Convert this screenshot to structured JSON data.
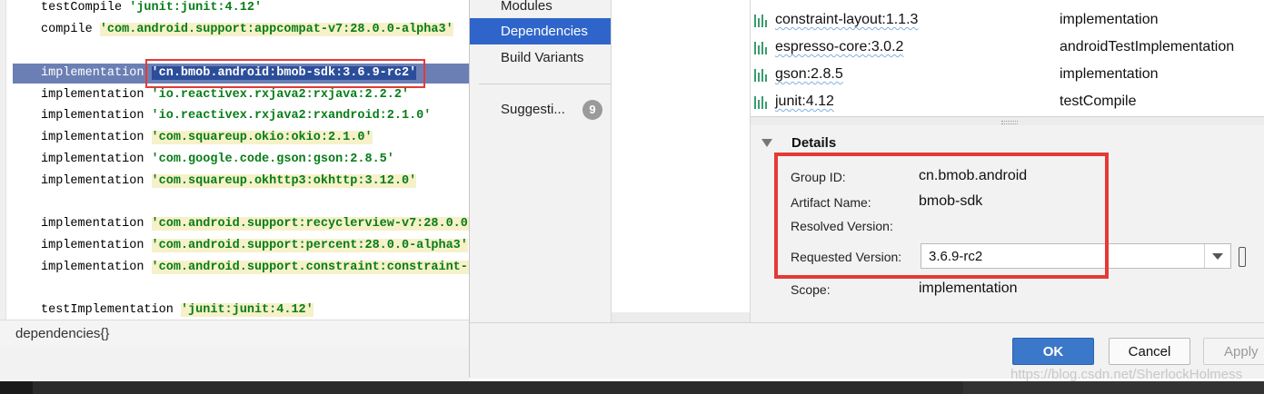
{
  "editor": {
    "lines": [
      {
        "prefix": "testCompile ",
        "string": "'junit:junit:4.12'",
        "hl": false
      },
      {
        "prefix": "compile ",
        "string": "'com.android.support:appcompat-v7:28.0.0-alpha3'",
        "hl": true
      },
      {
        "prefix": "implementation ",
        "string": "'cn.bmob.android:bmob-sdk:3.6.9-rc2'",
        "hl": true,
        "selected": true
      },
      {
        "prefix": "implementation ",
        "string": "'io.reactivex.rxjava2:rxjava:2.2.2'",
        "hl": false
      },
      {
        "prefix": "implementation ",
        "string": "'io.reactivex.rxjava2:rxandroid:2.1.0'",
        "hl": false
      },
      {
        "prefix": "implementation ",
        "string": "'com.squareup.okio:okio:2.1.0'",
        "hl": true
      },
      {
        "prefix": "implementation ",
        "string": "'com.google.code.gson:gson:2.8.5'",
        "hl": false
      },
      {
        "prefix": "implementation ",
        "string": "'com.squareup.okhttp3:okhttp:3.12.0'",
        "hl": true
      },
      {
        "prefix": "implementation ",
        "string": "'com.android.support:recyclerview-v7:28.0.0-",
        "hl": true
      },
      {
        "prefix": "implementation ",
        "string": "'com.android.support:percent:28.0.0-alpha3'",
        "hl": true
      },
      {
        "prefix": "implementation ",
        "string": "'com.android.support.constraint:constraint-l",
        "hl": true
      },
      {
        "prefix": "testImplementation ",
        "string": "'junit:junit:4.12'",
        "hl": true
      }
    ],
    "breadcrumb": "dependencies{}"
  },
  "dialog": {
    "nav": {
      "items": [
        "Modules",
        "Dependencies",
        "Build Variants"
      ],
      "active": "Dependencies",
      "suggestions_label": "Suggesti...",
      "suggestions_count": "9"
    },
    "dependencies": [
      {
        "name": "constraint-layout:1.1.3",
        "scope": "implementation"
      },
      {
        "name": "espresso-core:3.0.2",
        "scope": "androidTestImplementation"
      },
      {
        "name": "gson:2.8.5",
        "scope": "implementation"
      },
      {
        "name": "junit:4.12",
        "scope": "testCompile"
      }
    ],
    "details": {
      "title": "Details",
      "group_id_label": "Group ID:",
      "group_id": "cn.bmob.android",
      "artifact_label": "Artifact Name:",
      "artifact": "bmob-sdk",
      "resolved_label": "Resolved Version:",
      "resolved": "",
      "requested_label": "Requested Version:",
      "requested": "3.6.9-rc2",
      "scope_label": "Scope:",
      "scope": "implementation"
    },
    "buttons": {
      "ok": "OK",
      "cancel": "Cancel",
      "apply": "Apply"
    }
  },
  "watermark": "https://blog.csdn.net/SherlockHolmess",
  "colors": {
    "accent": "#2f65ca",
    "highlight_box": "#e53935",
    "string_green": "#067d17",
    "selection": "#6b7fb5"
  }
}
